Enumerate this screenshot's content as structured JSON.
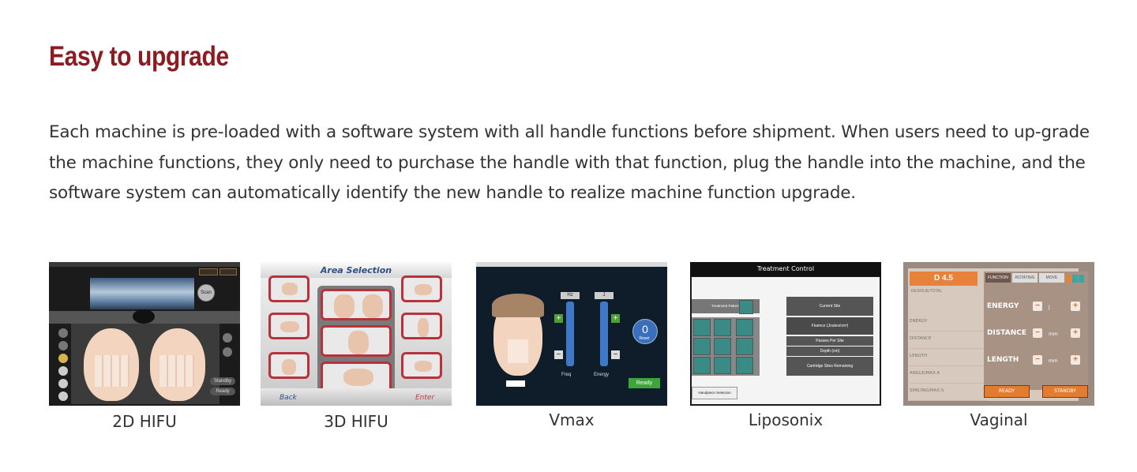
{
  "heading": "Easy to upgrade",
  "description": "Each machine is pre-loaded with a software system with all handle functions before shipment. When users need to up-grade the machine functions, they only need to purchase the handle with that function, plug the handle into the machine, and the software system can automatically identify the new handle to realize machine function upgrade.",
  "products": [
    {
      "caption": "2D HIFU",
      "screen": {
        "labels": [
          "Standby",
          "Ready"
        ]
      }
    },
    {
      "caption": "3D HIFU",
      "screen": {
        "title": "Area Selection",
        "back": "Back",
        "enter": "Enter"
      }
    },
    {
      "caption": "Vmax",
      "screen": {
        "freq_unit": "Hz",
        "energy_unit": "J",
        "freq_label": "Freq",
        "energy_label": "Energy",
        "counter": "0",
        "reset": "Reset",
        "ready": "Ready"
      }
    },
    {
      "caption": "Liposonix",
      "screen": {
        "title": "Treatment Control",
        "pattern": "Treatment Pattern",
        "current_site": "Current Site",
        "fluence": "Fluence (Joules/cm²)",
        "passes": "Passes Per Site",
        "depth": "Depth (cm)",
        "cartridge": "Cartridge Sites Remaining",
        "handpiece": "Handpiece Selection"
      }
    },
    {
      "caption": "Vaginal",
      "screen": {
        "mode": "D 4.5",
        "residual": "RESIDUE/TOTAL",
        "tabs": [
          "FUNCTION",
          "ROTATING",
          "MOVE"
        ],
        "rows": [
          "ENERGY",
          "DISTANCE",
          "LENGTH",
          "ANGLE/MAX.A",
          "SPACING/MAX.S"
        ],
        "controls": [
          {
            "label": "ENERGY",
            "unit": "J"
          },
          {
            "label": "DISTANCE",
            "unit": "mm"
          },
          {
            "label": "LENGTH",
            "unit": "mm"
          }
        ],
        "ready": "READY",
        "standby": "STANDBY"
      }
    }
  ],
  "colors": {
    "heading": "#8b1d22",
    "text": "#333333"
  }
}
